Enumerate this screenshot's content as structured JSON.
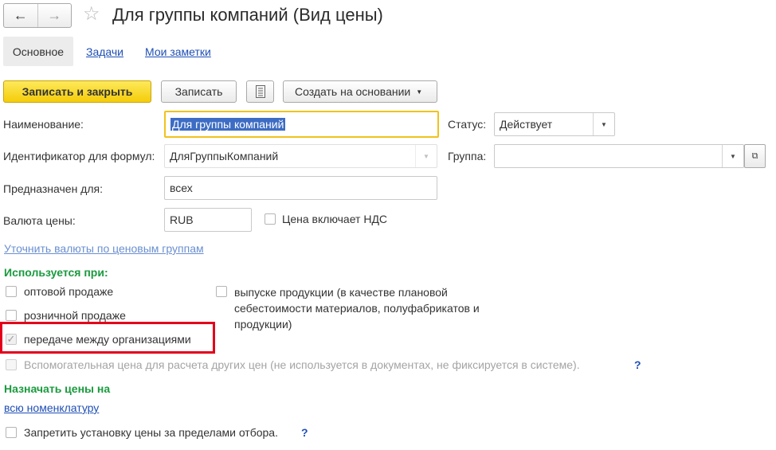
{
  "window": {
    "title": "Для группы компаний (Вид цены)",
    "nav_back_icon": "arrow-left-icon",
    "nav_forward_icon": "arrow-right-icon",
    "favorite_icon": "star-icon"
  },
  "tabs": [
    {
      "label": "Основное"
    },
    {
      "label": "Задачи"
    },
    {
      "label": "Мои заметки"
    }
  ],
  "toolbar": {
    "save_close_label": "Записать и закрыть",
    "save_label": "Записать",
    "report_icon": "document-icon",
    "create_based_label": "Создать на основании",
    "accent_color": "#f4cc0a"
  },
  "form": {
    "name_label": "Наименование:",
    "name_value": "Для группы компаний",
    "status_label": "Статус:",
    "status_value": "Действует",
    "formula_id_label": "Идентификатор для формул:",
    "formula_id_value": "ДляГруппыКомпаний",
    "group_label": "Группа:",
    "group_value": "",
    "intended_label": "Предназначен для:",
    "intended_value": "всех",
    "currency_label": "Валюта цены:",
    "currency_value": "RUB",
    "vat_label": "Цена включает НДС",
    "refine_currency_link": "Уточнить валюты по ценовым группам"
  },
  "usage": {
    "heading": "Используется при:",
    "wholesale": "оптовой продаже",
    "retail": "розничной продаже",
    "transfer": "передаче между организациями",
    "production": "выпуске продукции (в качестве плановой себестоимости материалов, полуфабрикатов и продукции)",
    "production_line1": "выпуске продукции (в качестве плановой",
    "production_line2": "себестоимости материалов, полуфабрикатов и",
    "production_line3": "продукции)",
    "auxiliary": "Вспомогательная цена для расчета других цен (не используется в документах, не фиксируется в системе).",
    "help": "?"
  },
  "assign": {
    "heading": "Назначать цены на",
    "all_items_link": "всю номенклатуру",
    "forbid_label": "Запретить установку цены за пределами отбора.",
    "help": "?"
  },
  "colors": {
    "highlight_border": "#e3001b",
    "section_heading": "#1a9a3e",
    "link": "#1f4fb5"
  }
}
